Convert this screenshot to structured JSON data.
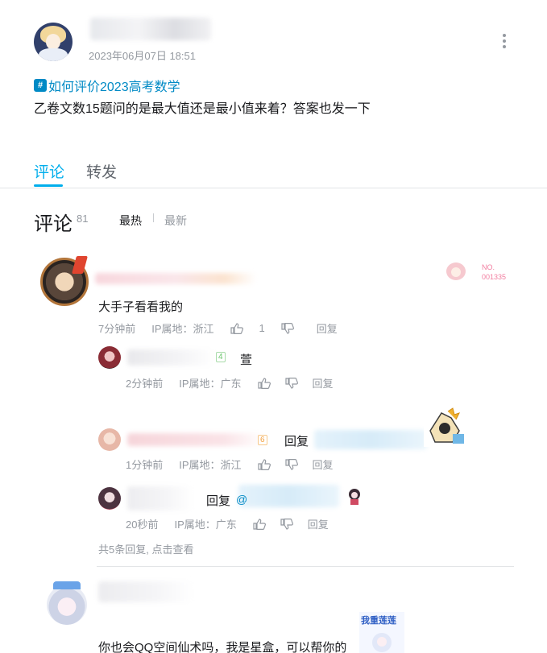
{
  "post": {
    "time": "2023年06月07日 18:51",
    "topic_badge": "#",
    "topic": "如何评价2023高考数学",
    "text": "乙卷文数15题问的是最大值还是最小值来着？答案也发一下"
  },
  "tabs": [
    {
      "label": "评论",
      "active": true
    },
    {
      "label": "转发",
      "active": false
    }
  ],
  "comments_section": {
    "title": "评论",
    "count": "81",
    "sort_hot": "最热",
    "sort_new": "最新"
  },
  "comments": [
    {
      "fan_badge_no": "NO.\n001335",
      "text": "大手子看看我的",
      "time": "7分钟前",
      "ip": "IP属地：浙江",
      "likes": "1",
      "reply_label": "回复",
      "replies": [
        {
          "level": "4",
          "text": "萱",
          "time": "2分钟前",
          "ip": "IP属地：广东",
          "reply_label": "回复"
        },
        {
          "level": "6",
          "text": "回复",
          "time": "1分钟前",
          "ip": "IP属地：浙江",
          "reply_label": "回复"
        },
        {
          "text": "回复",
          "at": "@",
          "time": "20秒前",
          "ip": "IP属地：广东",
          "reply_label": "回复"
        }
      ],
      "view_more": "共5条回复, 点击查看"
    },
    {
      "text": "你也会QQ空间仙术吗，我是星盒，可以帮你的",
      "sticker_label": "我重莲莲"
    }
  ],
  "colors": {
    "accent": "#00aeec",
    "link": "#008ac5",
    "meta": "#9499a0"
  }
}
